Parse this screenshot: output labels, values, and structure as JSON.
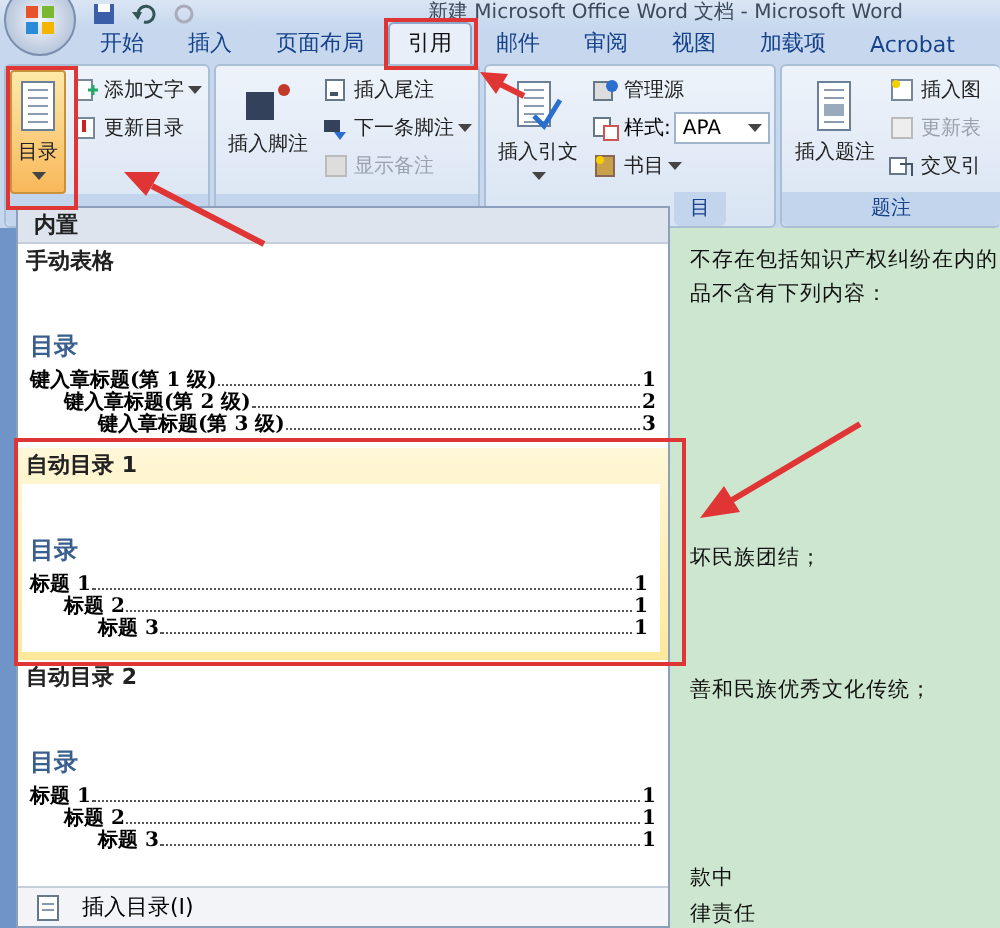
{
  "window": {
    "title": "新建 Microsoft Office Word 文档 - Microsoft Word"
  },
  "tabs": [
    {
      "label": "开始",
      "selected": false
    },
    {
      "label": "插入",
      "selected": false
    },
    {
      "label": "页面布局",
      "selected": false
    },
    {
      "label": "引用",
      "selected": true
    },
    {
      "label": "邮件",
      "selected": false
    },
    {
      "label": "审阅",
      "selected": false
    },
    {
      "label": "视图",
      "selected": false
    },
    {
      "label": "加载项",
      "selected": false
    },
    {
      "label": "Acrobat",
      "selected": false
    }
  ],
  "ribbon": {
    "groups": [
      {
        "large_button": {
          "label": "目录",
          "pressed": true,
          "dropdown": true
        },
        "small_buttons": [
          {
            "kind": "button",
            "label": "添加文字",
            "dropdown": true,
            "disabled": false
          },
          {
            "kind": "button",
            "label": "更新目录",
            "dropdown": false,
            "disabled": false
          }
        ]
      },
      {
        "large_button": {
          "label": "插入脚注",
          "pressed": false,
          "dropdown": false
        },
        "small_buttons": [
          {
            "kind": "button",
            "label": "插入尾注",
            "dropdown": false,
            "disabled": false
          },
          {
            "kind": "button",
            "label": "下一条脚注",
            "dropdown": true,
            "disabled": false
          },
          {
            "kind": "button",
            "label": "显示备注",
            "dropdown": false,
            "disabled": true
          }
        ]
      },
      {
        "large_button": {
          "label": "插入引文",
          "pressed": false,
          "dropdown": true
        },
        "label": "目",
        "small_buttons": [
          {
            "kind": "button",
            "label": "管理源",
            "dropdown": false,
            "disabled": false
          },
          {
            "kind": "combo",
            "label": "样式:",
            "value": "APA",
            "dropdown": true,
            "disabled": false
          },
          {
            "kind": "button",
            "label": "书目",
            "dropdown": true,
            "disabled": false
          }
        ]
      },
      {
        "large_button": {
          "label": "插入题注",
          "pressed": false,
          "dropdown": false
        },
        "label": "题注",
        "small_buttons": [
          {
            "kind": "button",
            "label": "插入图",
            "dropdown": false,
            "disabled": false
          },
          {
            "kind": "button",
            "label": "更新表",
            "dropdown": false,
            "disabled": true
          },
          {
            "kind": "button",
            "label": "交叉引",
            "dropdown": false,
            "disabled": false
          }
        ]
      }
    ]
  },
  "document": {
    "lines": [
      "不存在包括知识产权纠纷在内的",
      "品不含有下列内容：",
      "坏民族团结；",
      "善和民族优秀文化传统；",
      "款中",
      "律责任"
    ]
  },
  "toc_gallery": {
    "header": "内置",
    "items": [
      {
        "title": "手动表格",
        "selected": false,
        "preview": {
          "heading": "目录",
          "entries": [
            {
              "text": "键入章标题(第 1 级)",
              "page": "1",
              "children": [
                {
                  "text": "键入章标题(第 2 级)",
                  "page": "2",
                  "children": [
                    {
                      "text": "键入章标题(第 3 级)",
                      "page": "3"
                    }
                  ]
                }
              ]
            }
          ]
        }
      },
      {
        "title": "自动目录 1",
        "selected": true,
        "preview": {
          "heading": "目录",
          "entries": [
            {
              "text": "标题 1",
              "page": "1",
              "children": [
                {
                  "text": "标题 2",
                  "page": "1",
                  "children": [
                    {
                      "text": "标题 3",
                      "page": "1"
                    }
                  ]
                }
              ]
            }
          ]
        }
      },
      {
        "title": "自动目录 2",
        "selected": false,
        "preview": {
          "heading": "目录",
          "entries": [
            {
              "text": "标题 1",
              "page": "1",
              "children": [
                {
                  "text": "标题 2",
                  "page": "1",
                  "children": [
                    {
                      "text": "标题 3",
                      "page": "1"
                    }
                  ]
                }
              ]
            }
          ]
        }
      }
    ],
    "footer": "插入目录(I)"
  }
}
